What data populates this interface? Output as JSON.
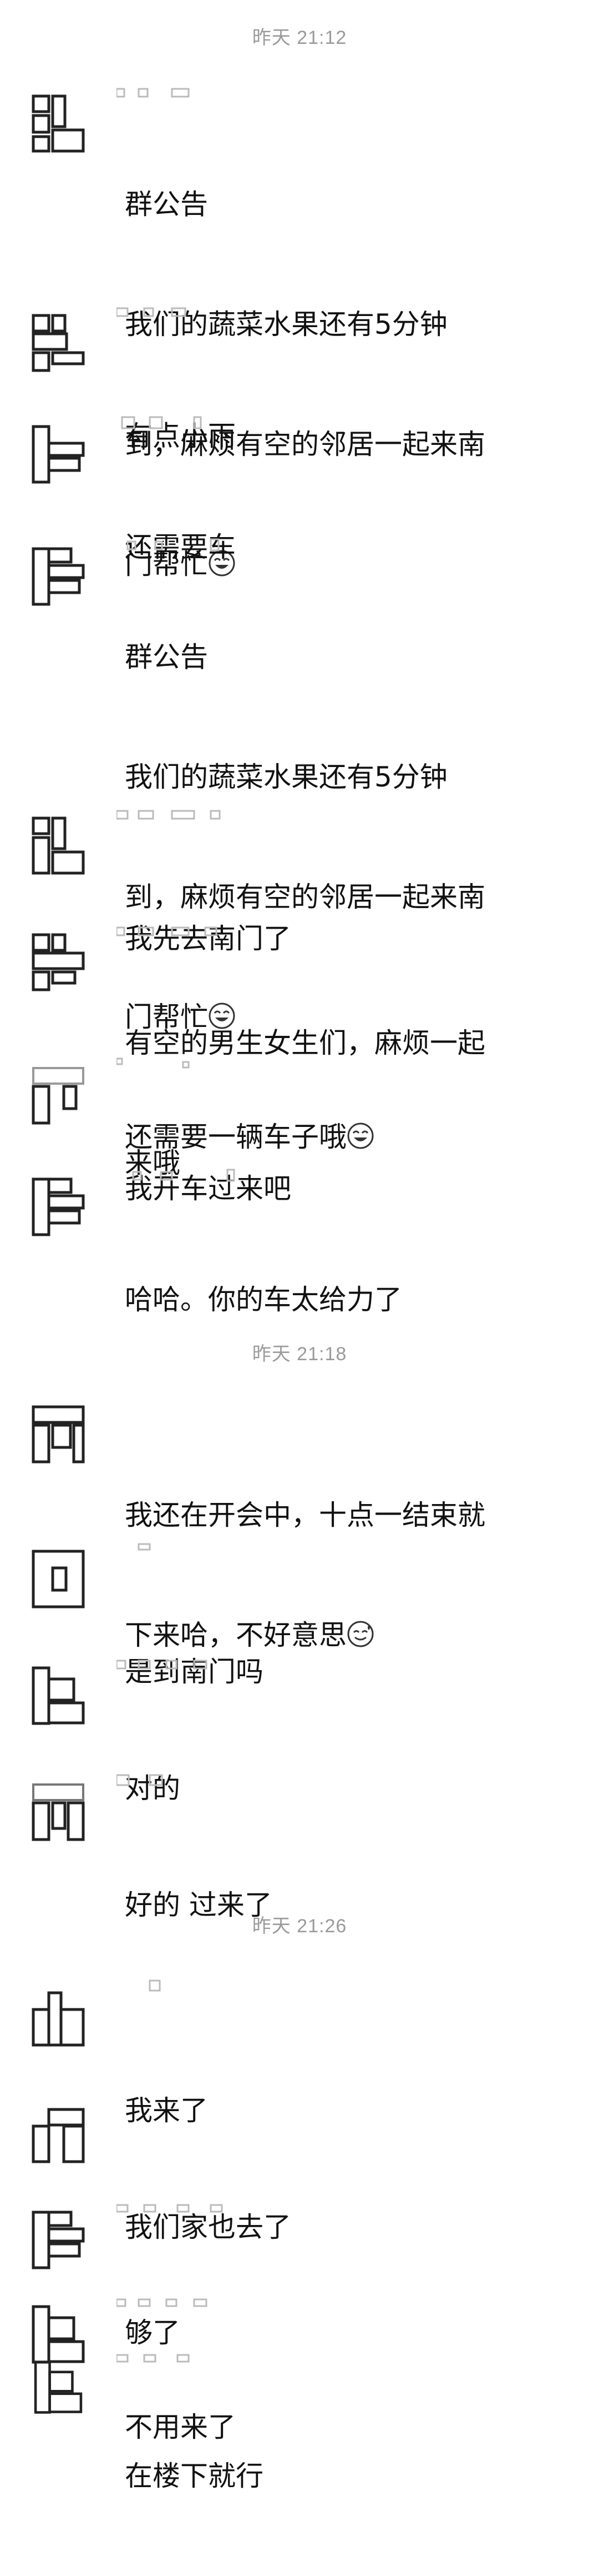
{
  "chat": {
    "time_dividers": [
      "昨天 21:12",
      "昨天 21:18",
      "昨天 21:26"
    ],
    "messages": [
      {
        "lines": [
          "群公告",
          "我们的蔬菜水果还有5分钟",
          "到，麻烦有空的邻居一起来南",
          "门帮忙"
        ],
        "emoji_after_line": 3,
        "emoji": "laughing-tears-emoji"
      },
      {
        "lines": [
          "有点小雨"
        ]
      },
      {
        "lines": [
          "还需要车"
        ]
      },
      {
        "lines": [
          "群公告",
          "我们的蔬菜水果还有5分钟",
          "到，麻烦有空的邻居一起来南",
          "门帮忙",
          "还需要一辆车子哦"
        ],
        "emoji_after_line": 4,
        "emoji": "laughing-tears-emoji",
        "emoji_line3": "laughing-tears-emoji"
      },
      {
        "lines": [
          "我先去南门了"
        ]
      },
      {
        "lines": [
          "有空的男生女生们，麻烦一起",
          "来哦"
        ]
      },
      {
        "lines": [
          "我开车过来吧"
        ]
      },
      {
        "lines": [
          "哈哈。你的车太给力了"
        ]
      },
      {
        "lines": [
          "我还在开会中，十点一结束就",
          "下来哈，不好意思"
        ],
        "emoji_after_line": 1,
        "emoji": "sweat-smile-emoji"
      },
      {
        "lines": [
          "是到南门吗"
        ]
      },
      {
        "lines": [
          "对的"
        ]
      },
      {
        "lines": [
          "好的 过来了"
        ]
      },
      {
        "lines": [
          "我来了"
        ]
      },
      {
        "lines": [
          "我们家也去了"
        ]
      },
      {
        "lines": [
          "够了"
        ]
      },
      {
        "lines": [
          "不用来了"
        ]
      },
      {
        "lines": [
          "在楼下就行"
        ]
      }
    ]
  },
  "colors": {
    "background": "#ffffff",
    "text": "#111111",
    "divider_text": "#9a9a9a",
    "mosaic": "#222222",
    "emoji": "#f5c518"
  }
}
